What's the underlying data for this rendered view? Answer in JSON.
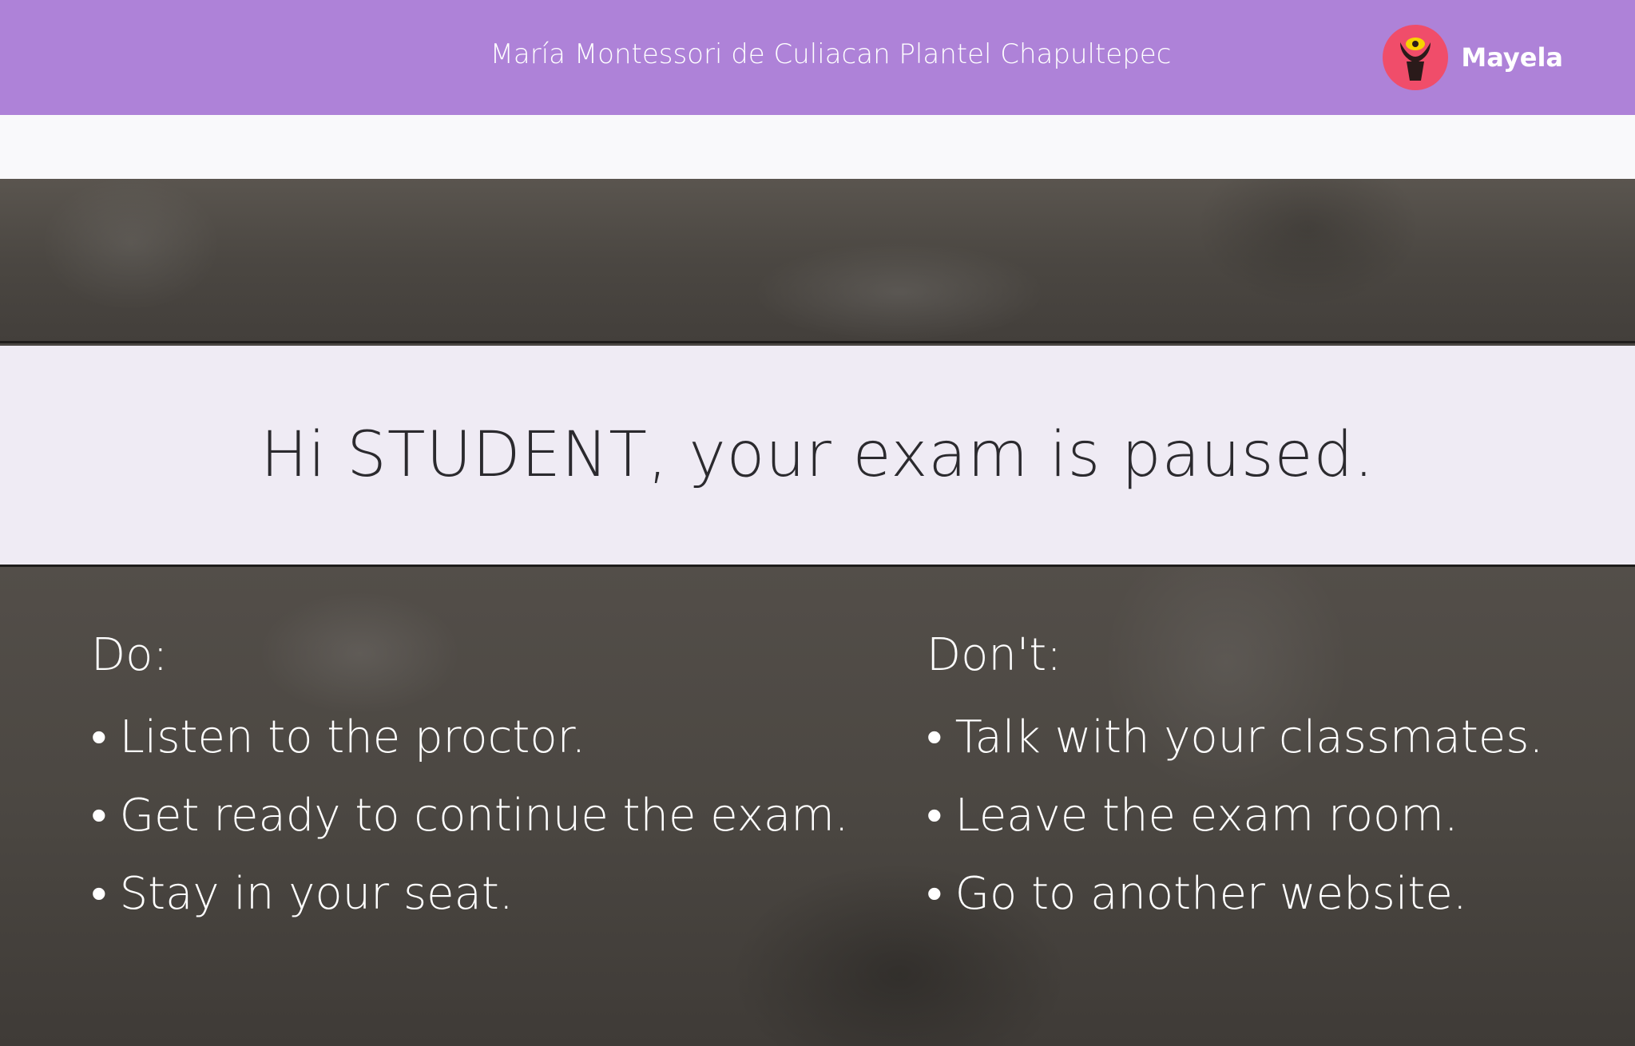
{
  "header": {
    "school_name": "María Montessori de Culiacan Plantel Chapultepec",
    "user_name": "Mayela"
  },
  "banner": {
    "message": "Hi STUDENT, your exam is paused."
  },
  "do": {
    "title": "Do:",
    "items": [
      "Listen to the proctor.",
      "Get ready to continue the exam.",
      "Stay in your seat."
    ]
  },
  "dont": {
    "title": "Don't:",
    "items": [
      "Talk with your classmates.",
      "Leave the exam room.",
      "Go to another website."
    ]
  },
  "colors": {
    "header_bg": "#ae82d8",
    "avatar_bg": "#f04d6a",
    "banner_bg": "#efebf4"
  },
  "icons": {
    "avatar": "monster-avatar-icon"
  }
}
